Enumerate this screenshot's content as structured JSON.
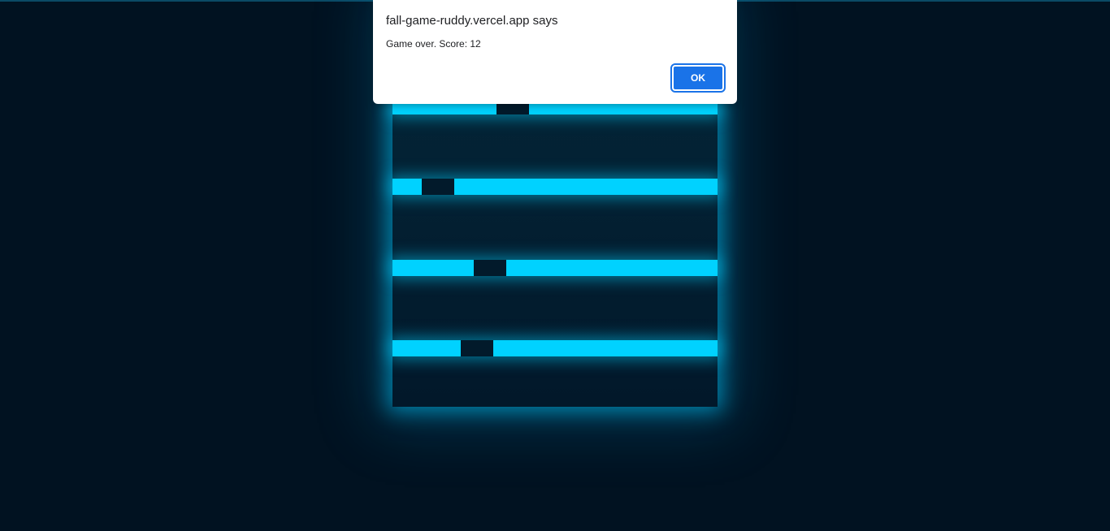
{
  "dialog": {
    "title": "fall-game-ruddy.vercel.app says",
    "message": "Game over. Score: 12",
    "ok_label": "OK"
  },
  "game": {
    "score": 12,
    "floor_color": "#00d2ff",
    "gap_color": "#021a2b",
    "background_color": "#011221"
  }
}
